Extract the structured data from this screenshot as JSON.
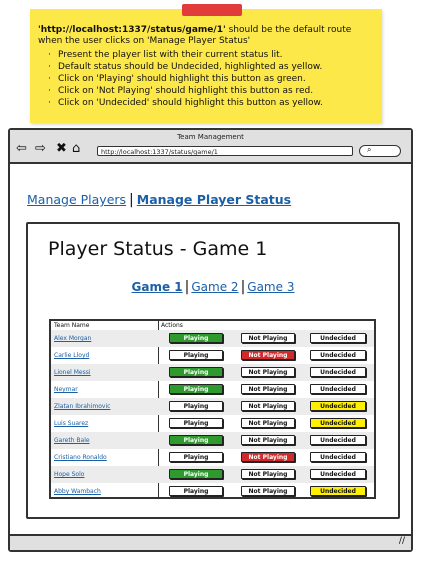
{
  "note": {
    "route": "'http://localhost:1337/status/game/1'",
    "heading_rest": " should be the default route when the user clicks on 'Manage Player Status'",
    "bullets": [
      "Present the player list with their current status lit.",
      "Default status should be Undecided, highlighted as yellow.",
      "Click on 'Playing' should highlight this button as green.",
      "Click on 'Not Playing' should highlight this button as red.",
      "Click on 'Undecided' should highlight this button as yellow."
    ]
  },
  "window": {
    "title": "Team Management",
    "url": "http://localhost:1337/status/game/1",
    "search_icon": "magnifier-icon"
  },
  "topnav": {
    "manage_players": "Manage Players",
    "manage_status": "Manage Player Status"
  },
  "panel": {
    "title": "Player Status - Game 1",
    "games": [
      "Game 1",
      "Game 2",
      "Game 3"
    ]
  },
  "table": {
    "col_name": "Team Name",
    "col_actions": "Actions",
    "btn_playing": "Playing",
    "btn_not_playing": "Not Playing",
    "btn_undecided": "Undecided",
    "colors": {
      "playing": "#2e9a2e",
      "not_playing": "#d02a2a",
      "undecided": "#ffef00"
    },
    "rows": [
      {
        "name": "Alex Morgan",
        "status": "playing"
      },
      {
        "name": "Carlie Lloyd",
        "status": "not_playing"
      },
      {
        "name": "Lionel Messi",
        "status": "playing"
      },
      {
        "name": "Neymar",
        "status": "playing"
      },
      {
        "name": "Zlatan Ibrahimovic",
        "status": "undecided"
      },
      {
        "name": "Luis Suarez",
        "status": "undecided"
      },
      {
        "name": "Gareth Bale",
        "status": "playing"
      },
      {
        "name": "Cristiano Ronaldo",
        "status": "not_playing"
      },
      {
        "name": "Hope Solo",
        "status": "playing"
      },
      {
        "name": "Abby Wambach",
        "status": "undecided"
      }
    ]
  }
}
